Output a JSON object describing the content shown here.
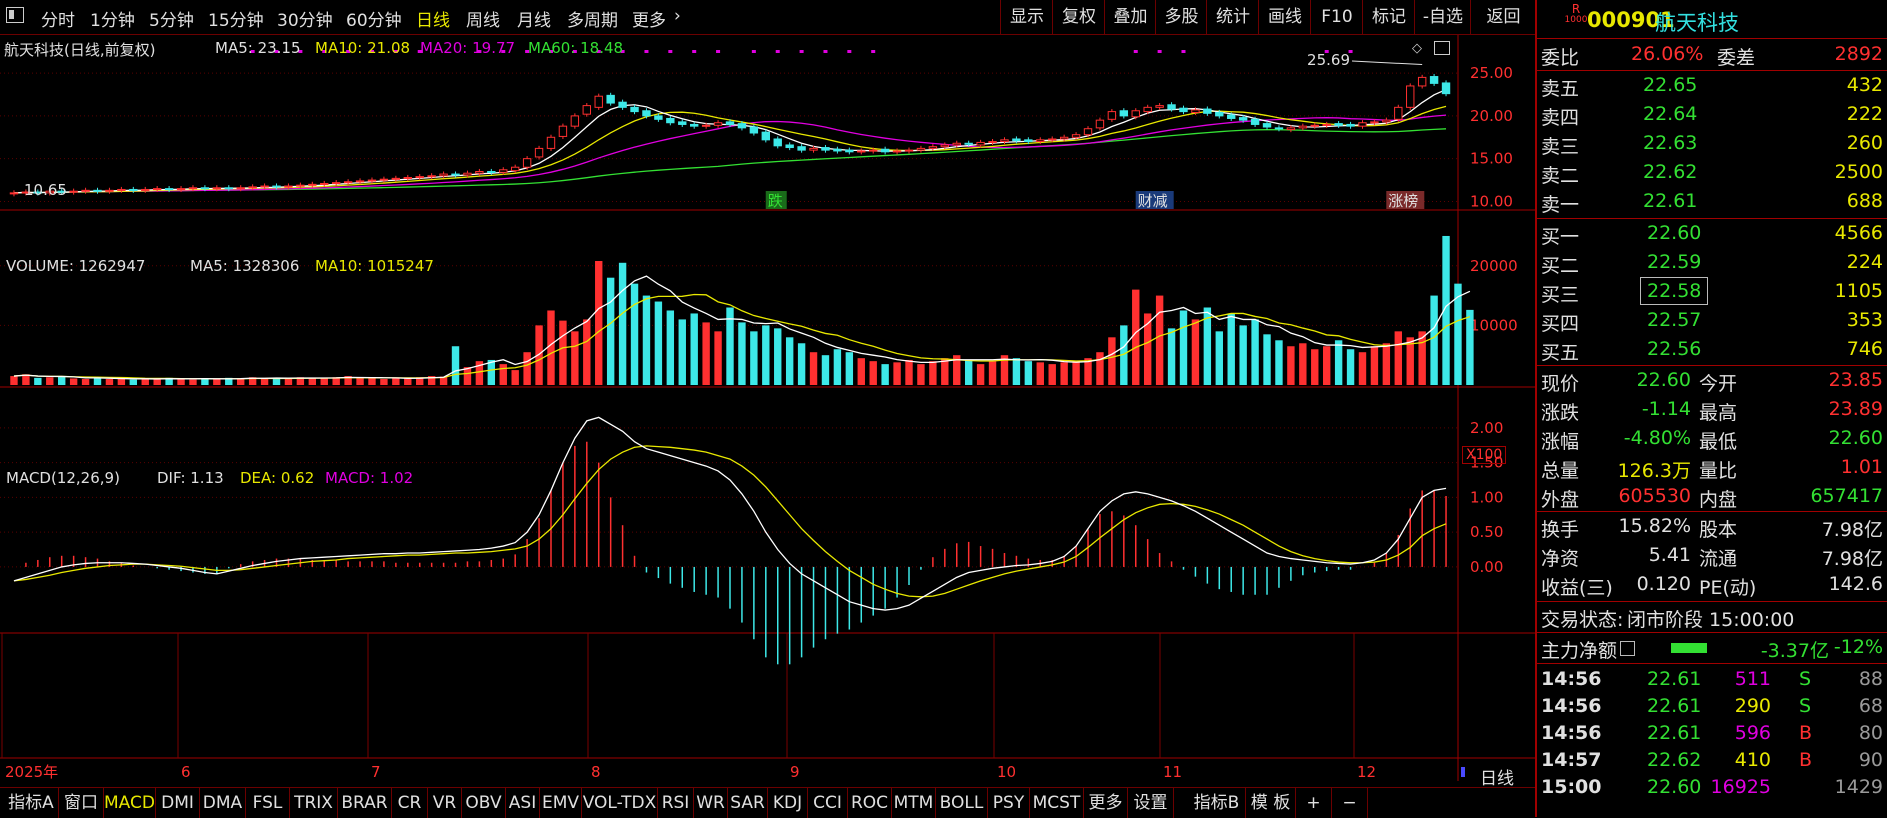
{
  "toolbar": {
    "left": [
      "分时",
      "1分钟",
      "5分钟",
      "15分钟",
      "30分钟",
      "60分钟",
      "日线",
      "周线",
      "月线",
      "多周期",
      "更多"
    ],
    "active": "日线",
    "right": [
      "显示",
      "复权",
      "叠加",
      "多股",
      "统计",
      "画线",
      "F10",
      "标记",
      "-自选",
      "返回"
    ]
  },
  "main_header": {
    "name": "航天科技(日线,前复权)",
    "ma5": "MA5: 23.15",
    "ma10": "MA10: 21.08",
    "ma20": "MA20: 19.77",
    "ma60": "MA60: 18.48"
  },
  "price_axis": [
    "25.00",
    "20.00",
    "15.00",
    "10.00"
  ],
  "price_marks": {
    "high": "25.69",
    "low": "10.65"
  },
  "event_labels": [
    "跌",
    "财减",
    "涨榜"
  ],
  "volume_header": {
    "name": "VOLUME: 1262947",
    "ma5": "MA5: 1328306",
    "ma10": "MA10: 1015247"
  },
  "volume_axis": [
    "20000",
    "10000"
  ],
  "volume_unit": "X100",
  "macd_header": {
    "name": "MACD(12,26,9)",
    "dif": "DIF: 1.13",
    "dea": "DEA: 0.62",
    "macd": "MACD: 1.02"
  },
  "macd_axis": [
    "2.00",
    "1.50",
    "1.00",
    "0.50",
    "0.00"
  ],
  "time_axis": [
    "2025年",
    "6",
    "7",
    "8",
    "9",
    "10",
    "11",
    "12"
  ],
  "period_label": "日线",
  "bottom_tabs": [
    "指标A",
    "窗口",
    "MACD",
    "DMI",
    "DMA",
    "FSL",
    "TRIX",
    "BRAR",
    "CR",
    "VR",
    "OBV",
    "ASI",
    "EMV",
    "VOL-TDX",
    "RSI",
    "WR",
    "SAR",
    "KDJ",
    "CCI",
    "ROC",
    "MTM",
    "BOLL",
    "PSY",
    "MCST",
    "更多",
    "设置",
    "指标B",
    "模 板",
    "+",
    "−"
  ],
  "bottom_active": "MACD",
  "quote": {
    "badge_top": "R",
    "badge_bottom": "1000",
    "code": "000901",
    "name": "航天科技",
    "weibi_label": "委比",
    "weibi": "26.06%",
    "weicha_label": "委差",
    "weicha": "2892",
    "asks": [
      {
        "label": "卖五",
        "price": "22.65",
        "vol": "432"
      },
      {
        "label": "卖四",
        "price": "22.64",
        "vol": "222"
      },
      {
        "label": "卖三",
        "price": "22.63",
        "vol": "260"
      },
      {
        "label": "卖二",
        "price": "22.62",
        "vol": "2500"
      },
      {
        "label": "卖一",
        "price": "22.61",
        "vol": "688"
      }
    ],
    "bids": [
      {
        "label": "买一",
        "price": "22.60",
        "vol": "4566"
      },
      {
        "label": "买二",
        "price": "22.59",
        "vol": "224"
      },
      {
        "label": "买三",
        "price": "22.58",
        "vol": "1105"
      },
      {
        "label": "买四",
        "price": "22.57",
        "vol": "353"
      },
      {
        "label": "买五",
        "price": "22.56",
        "vol": "746"
      }
    ],
    "stats": [
      {
        "l1": "现价",
        "v1": "22.60",
        "c1": "#33e033",
        "l2": "今开",
        "v2": "23.85",
        "c2": "#ff3030"
      },
      {
        "l1": "涨跌",
        "v1": "-1.14",
        "c1": "#33e033",
        "l2": "最高",
        "v2": "23.89",
        "c2": "#ff3030"
      },
      {
        "l1": "涨幅",
        "v1": "-4.80%",
        "c1": "#33e033",
        "l2": "最低",
        "v2": "22.60",
        "c2": "#33e033"
      },
      {
        "l1": "总量",
        "v1": "126.3万",
        "c1": "#e8e800",
        "l2": "量比",
        "v2": "1.01",
        "c2": "#ff3030"
      },
      {
        "l1": "外盘",
        "v1": "605530",
        "c1": "#ff3030",
        "l2": "内盘",
        "v2": "657417",
        "c2": "#33e033"
      }
    ],
    "stats2": [
      {
        "l1": "换手",
        "v1": "15.82%",
        "l2": "股本",
        "v2": "7.98亿"
      },
      {
        "l1": "净资",
        "v1": "5.41",
        "l2": "流通",
        "v2": "7.98亿"
      },
      {
        "l1": "收益(三)",
        "v1": "0.120",
        "l2": "PE(动)",
        "v2": "142.6"
      }
    ],
    "trade_status_label": "交易状态:",
    "trade_status": "闭市阶段 15:00:00",
    "main_flow_label": "主力净额",
    "main_flow_value": "-3.37亿",
    "main_flow_pct": "-12%",
    "ticks": [
      {
        "time": "14:56",
        "price": "22.61",
        "vol": "511",
        "vc": "#e000e0",
        "side": "S",
        "sc": "#33e033",
        "n": "88"
      },
      {
        "time": "14:56",
        "price": "22.61",
        "vol": "290",
        "vc": "#e8e800",
        "side": "S",
        "sc": "#33e033",
        "n": "68"
      },
      {
        "time": "14:56",
        "price": "22.61",
        "vol": "596",
        "vc": "#e000e0",
        "side": "B",
        "sc": "#ff3030",
        "n": "80"
      },
      {
        "time": "14:57",
        "price": "22.62",
        "vol": "410",
        "vc": "#e8e800",
        "side": "B",
        "sc": "#ff3030",
        "n": "90"
      },
      {
        "time": "15:00",
        "price": "22.60",
        "vol": "16925",
        "vc": "#e000e0",
        "side": "",
        "sc": "#33e033",
        "n": "1429"
      }
    ]
  },
  "chart_data": {
    "type": "candlestick",
    "price_range": [
      9.0,
      27.0
    ],
    "close": [
      11.0,
      11.1,
      11.0,
      11.2,
      11.1,
      11.2,
      11.3,
      11.2,
      11.3,
      11.4,
      11.3,
      11.4,
      11.5,
      11.4,
      11.5,
      11.6,
      11.5,
      11.6,
      11.5,
      11.6,
      11.7,
      11.8,
      11.7,
      11.8,
      11.9,
      12.0,
      12.1,
      12.2,
      12.3,
      12.4,
      12.5,
      12.6,
      12.7,
      12.8,
      12.9,
      13.0,
      13.2,
      13.1,
      13.3,
      13.5,
      13.4,
      13.7,
      14.0,
      15.0,
      16.2,
      17.5,
      18.8,
      20.0,
      21.2,
      22.3,
      21.5,
      21.0,
      20.5,
      20.0,
      19.6,
      19.2,
      19.0,
      18.8,
      18.9,
      19.2,
      19.0,
      18.6,
      18.0,
      17.2,
      16.5,
      16.3,
      16.0,
      16.2,
      16.0,
      15.9,
      15.8,
      15.9,
      16.0,
      15.8,
      15.9,
      16.0,
      16.2,
      16.4,
      16.6,
      16.8,
      16.7,
      16.9,
      17.0,
      17.2,
      17.1,
      17.0,
      17.2,
      17.3,
      17.5,
      17.8,
      18.5,
      19.5,
      20.5,
      20.0,
      20.6,
      21.0,
      21.2,
      20.8,
      20.5,
      20.7,
      20.3,
      20.0,
      19.7,
      19.5,
      19.0,
      18.7,
      18.5,
      18.6,
      18.8,
      18.9,
      19.0,
      18.9,
      18.8,
      19.2,
      19.3,
      19.5,
      21.0,
      23.5,
      24.5,
      23.8,
      22.6
    ],
    "open": [
      10.9,
      11.0,
      11.1,
      11.0,
      11.2,
      11.1,
      11.2,
      11.3,
      11.2,
      11.3,
      11.4,
      11.3,
      11.4,
      11.5,
      11.4,
      11.5,
      11.6,
      11.5,
      11.6,
      11.5,
      11.6,
      11.7,
      11.8,
      11.7,
      11.8,
      11.9,
      12.0,
      12.1,
      12.2,
      12.3,
      12.4,
      12.5,
      12.6,
      12.7,
      12.8,
      12.9,
      13.0,
      13.2,
      13.1,
      13.3,
      13.5,
      13.4,
      13.6,
      14.0,
      15.2,
      16.2,
      17.6,
      18.8,
      20.2,
      21.0,
      22.4,
      21.6,
      21.0,
      20.6,
      20.0,
      19.7,
      19.3,
      19.0,
      18.8,
      18.9,
      19.3,
      19.1,
      18.7,
      18.1,
      17.3,
      16.6,
      16.4,
      16.0,
      16.3,
      16.1,
      16.0,
      15.8,
      15.9,
      16.1,
      15.8,
      15.9,
      16.0,
      16.2,
      16.4,
      16.6,
      16.8,
      16.6,
      16.9,
      17.0,
      17.3,
      17.2,
      17.0,
      17.2,
      17.3,
      17.5,
      17.8,
      18.6,
      19.6,
      20.6,
      19.9,
      20.5,
      21.0,
      21.3,
      20.9,
      20.4,
      20.8,
      20.4,
      20.1,
      19.8,
      19.6,
      19.1,
      18.6,
      18.4,
      18.6,
      18.8,
      18.9,
      19.1,
      19.0,
      18.8,
      19.2,
      19.3,
      19.6,
      21.0,
      23.5,
      24.6,
      23.85
    ],
    "volume": [
      1500,
      1800,
      1200,
      1300,
      1400,
      1100,
      1000,
      1200,
      1000,
      1100,
      900,
      1000,
      1100,
      1200,
      1000,
      900,
      1100,
      1000,
      1200,
      1100,
      1300,
      1000,
      1200,
      1100,
      1300,
      1200,
      1100,
      1300,
      1500,
      1200,
      1100,
      1000,
      1200,
      1100,
      1300,
      1500,
      1400,
      6500,
      3000,
      4000,
      4200,
      3500,
      2500,
      5500,
      10000,
      12500,
      10800,
      9000,
      11000,
      20800,
      18000,
      20500,
      17000,
      15000,
      14000,
      12500,
      11000,
      12000,
      10500,
      9000,
      13000,
      10500,
      9000,
      10000,
      9500,
      8000,
      7000,
      5500,
      5000,
      6000,
      5500,
      4500,
      4000,
      3500,
      3800,
      4200,
      3500,
      4000,
      4500,
      5000,
      4200,
      3500,
      4000,
      5000,
      4500,
      4000,
      3800,
      3500,
      3800,
      4000,
      4500,
      5500,
      8000,
      10000,
      16000,
      12000,
      15000,
      9500,
      12500,
      11000,
      13000,
      9000,
      12000,
      10000,
      11000,
      8500,
      7500,
      6500,
      7000,
      6000,
      6500,
      7500,
      6000,
      5500,
      6500,
      7000,
      9000,
      8000,
      9000,
      15000,
      25000,
      17000,
      12600
    ],
    "macd_range": [
      -0.95,
      2.4
    ],
    "dif": [
      -0.2,
      -0.15,
      -0.1,
      -0.05,
      0.0,
      0.03,
      0.05,
      0.06,
      0.06,
      0.06,
      0.05,
      0.04,
      0.02,
      0.0,
      -0.02,
      -0.05,
      -0.08,
      -0.1,
      -0.06,
      -0.02,
      0.02,
      0.05,
      0.08,
      0.1,
      0.12,
      0.13,
      0.14,
      0.15,
      0.16,
      0.17,
      0.18,
      0.19,
      0.19,
      0.2,
      0.2,
      0.21,
      0.22,
      0.23,
      0.24,
      0.25,
      0.27,
      0.3,
      0.35,
      0.5,
      0.75,
      1.1,
      1.5,
      1.85,
      2.1,
      2.15,
      2.05,
      1.95,
      1.8,
      1.7,
      1.65,
      1.6,
      1.55,
      1.5,
      1.45,
      1.38,
      1.25,
      1.05,
      0.8,
      0.5,
      0.25,
      0.05,
      -0.1,
      -0.2,
      -0.3,
      -0.4,
      -0.5,
      -0.55,
      -0.6,
      -0.62,
      -0.6,
      -0.55,
      -0.45,
      -0.35,
      -0.25,
      -0.15,
      -0.08,
      -0.05,
      -0.02,
      0.0,
      0.02,
      0.03,
      0.05,
      0.08,
      0.15,
      0.3,
      0.55,
      0.8,
      0.95,
      1.05,
      1.08,
      1.05,
      1.0,
      0.95,
      0.88,
      0.8,
      0.7,
      0.6,
      0.5,
      0.4,
      0.3,
      0.2,
      0.15,
      0.12,
      0.1,
      0.08,
      0.06,
      0.05,
      0.04,
      0.06,
      0.1,
      0.2,
      0.4,
      0.7,
      1.0,
      1.1,
      1.13
    ],
    "dea": [
      -0.2,
      -0.18,
      -0.15,
      -0.12,
      -0.08,
      -0.05,
      -0.02,
      0.0,
      0.02,
      0.03,
      0.04,
      0.04,
      0.03,
      0.02,
      0.01,
      -0.01,
      -0.03,
      -0.05,
      -0.05,
      -0.04,
      -0.02,
      0.0,
      0.02,
      0.04,
      0.06,
      0.08,
      0.09,
      0.1,
      0.12,
      0.13,
      0.14,
      0.15,
      0.16,
      0.17,
      0.17,
      0.18,
      0.19,
      0.2,
      0.2,
      0.21,
      0.22,
      0.24,
      0.26,
      0.3,
      0.4,
      0.55,
      0.75,
      0.98,
      1.2,
      1.4,
      1.55,
      1.65,
      1.72,
      1.74,
      1.73,
      1.72,
      1.7,
      1.68,
      1.65,
      1.6,
      1.55,
      1.45,
      1.32,
      1.15,
      0.95,
      0.75,
      0.55,
      0.38,
      0.22,
      0.08,
      -0.05,
      -0.15,
      -0.25,
      -0.32,
      -0.38,
      -0.42,
      -0.43,
      -0.42,
      -0.38,
      -0.32,
      -0.26,
      -0.2,
      -0.15,
      -0.1,
      -0.06,
      -0.03,
      0.0,
      0.03,
      0.07,
      0.15,
      0.28,
      0.42,
      0.55,
      0.68,
      0.78,
      0.85,
      0.9,
      0.91,
      0.9,
      0.87,
      0.82,
      0.76,
      0.68,
      0.6,
      0.5,
      0.4,
      0.3,
      0.22,
      0.16,
      0.12,
      0.09,
      0.07,
      0.06,
      0.06,
      0.07,
      0.1,
      0.17,
      0.28,
      0.45,
      0.55,
      0.62
    ]
  }
}
